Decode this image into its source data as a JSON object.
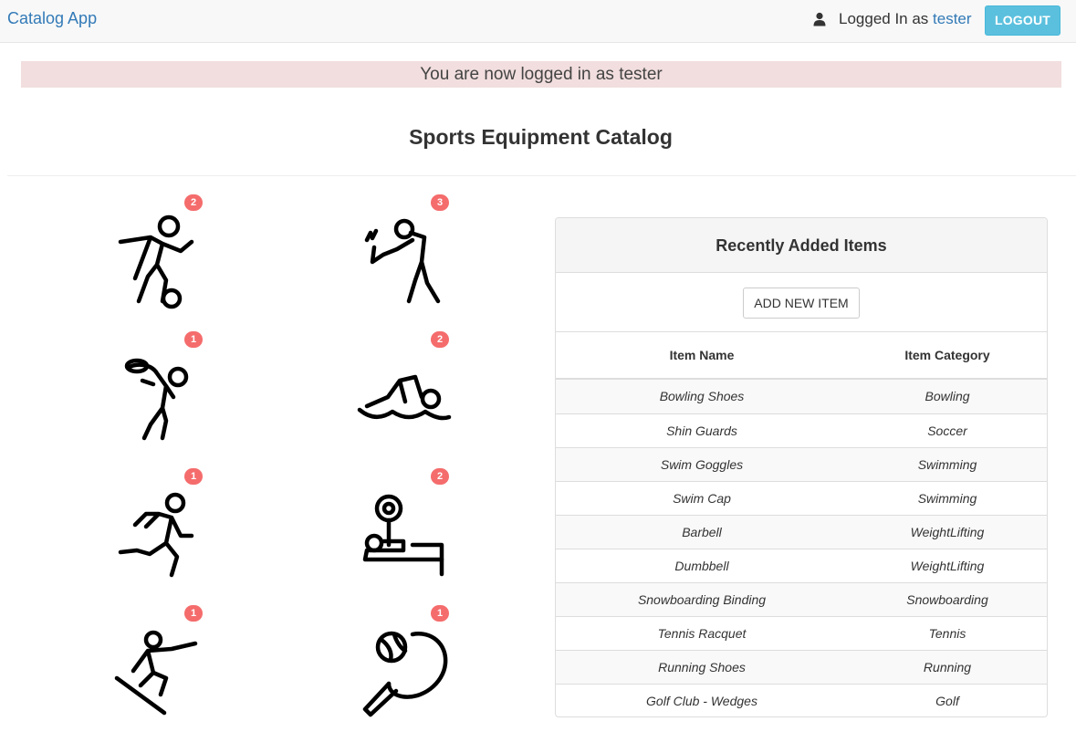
{
  "navbar": {
    "brand": "Catalog App",
    "logged_in_prefix": "Logged In as ",
    "username": "tester",
    "logout_label": "LOGOUT",
    "user_icon": "user-icon"
  },
  "flash": {
    "message": "You are now logged in as tester"
  },
  "page": {
    "title": "Sports Equipment Catalog"
  },
  "categories": [
    {
      "icon": "soccer-icon",
      "count": "2"
    },
    {
      "icon": "golf-icon",
      "count": "3"
    },
    {
      "icon": "bowling-icon",
      "count": "1"
    },
    {
      "icon": "swimming-icon",
      "count": "2"
    },
    {
      "icon": "running-icon",
      "count": "1"
    },
    {
      "icon": "weightlifting-icon",
      "count": "2"
    },
    {
      "icon": "snowboarding-icon",
      "count": "1"
    },
    {
      "icon": "tennis-icon",
      "count": "1"
    }
  ],
  "panel": {
    "title": "Recently Added Items",
    "add_label": "ADD NEW ITEM",
    "col_name": "Item Name",
    "col_category": "Item Category",
    "items": [
      {
        "name": "Bowling Shoes",
        "category": "Bowling"
      },
      {
        "name": "Shin Guards",
        "category": "Soccer"
      },
      {
        "name": "Swim Goggles",
        "category": "Swimming"
      },
      {
        "name": "Swim Cap",
        "category": "Swimming"
      },
      {
        "name": "Barbell",
        "category": "WeightLifting"
      },
      {
        "name": "Dumbbell",
        "category": "WeightLifting"
      },
      {
        "name": "Snowboarding Binding",
        "category": "Snowboarding"
      },
      {
        "name": "Tennis Racquet",
        "category": "Tennis"
      },
      {
        "name": "Running Shoes",
        "category": "Running"
      },
      {
        "name": "Golf Club - Wedges",
        "category": "Golf"
      }
    ]
  },
  "colors": {
    "brand": "#337ab7",
    "logout": "#5bc0de",
    "flash_bg": "#f2dede",
    "badge": "#f56c6c"
  }
}
